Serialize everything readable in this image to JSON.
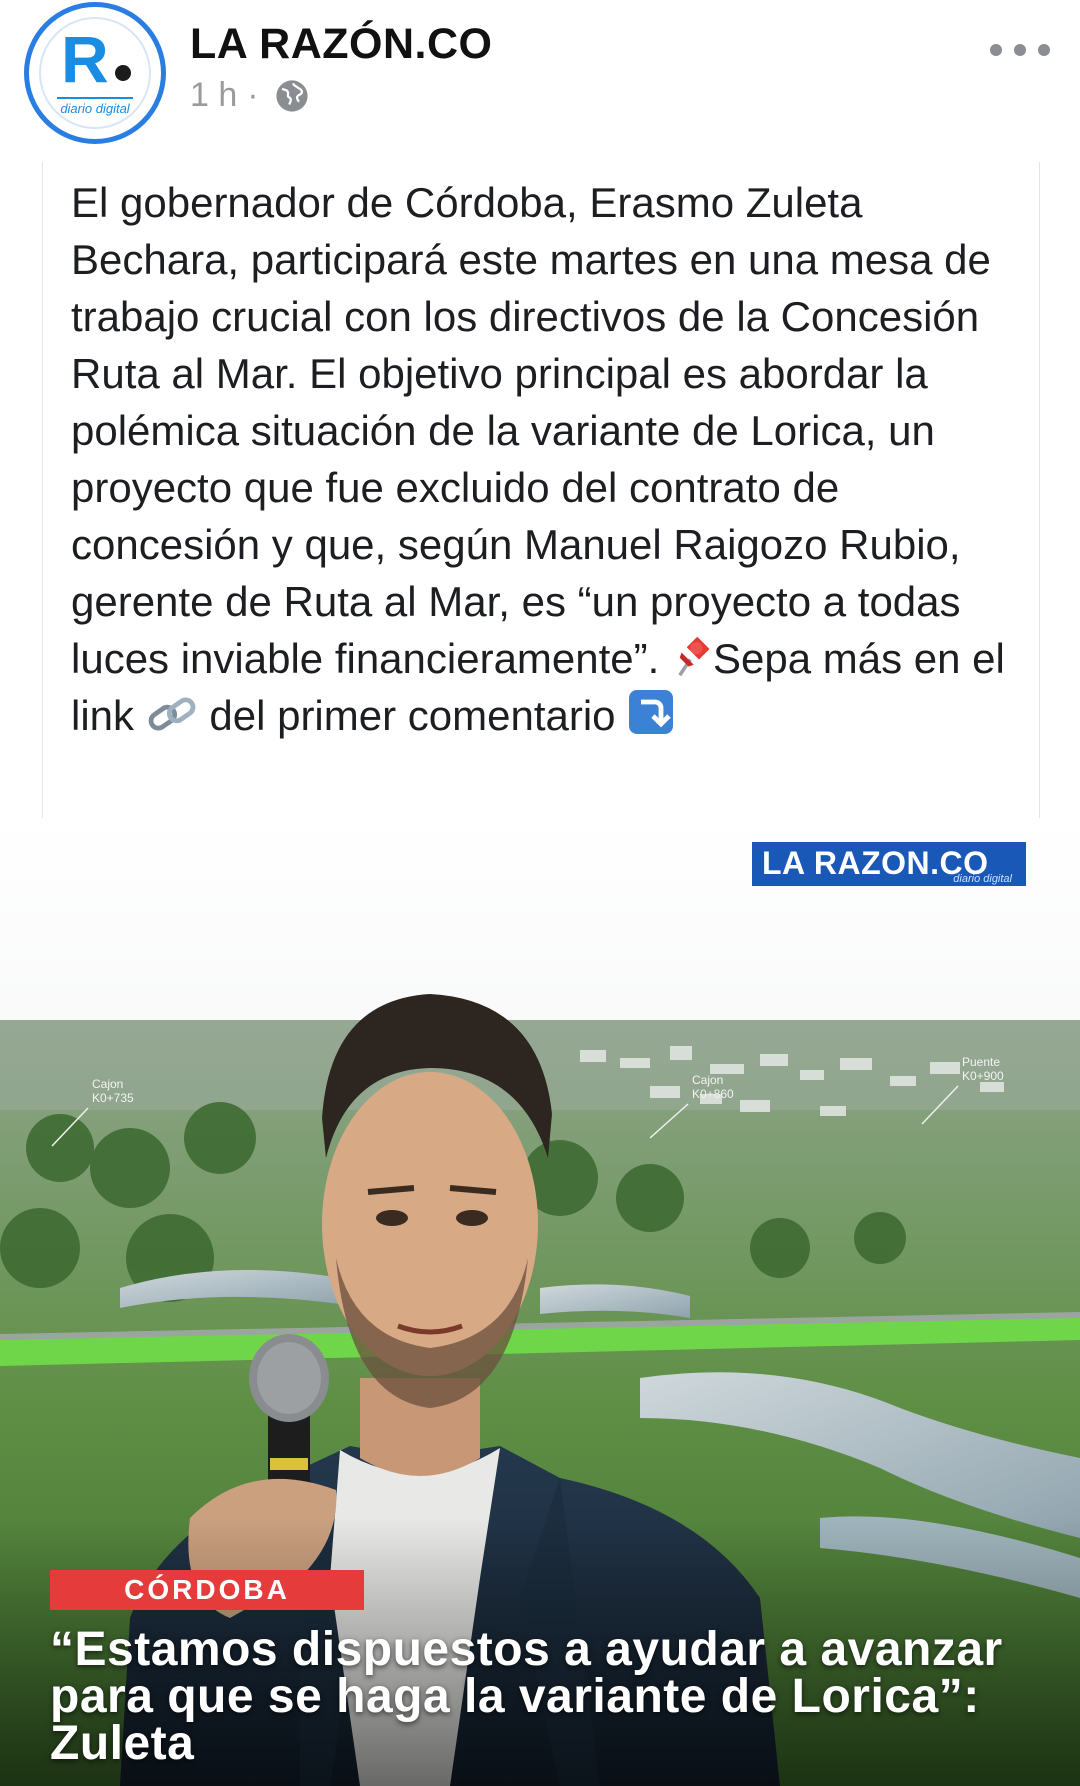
{
  "post": {
    "page_name": "LA RAZÓN.CO",
    "avatar": {
      "letter": "R",
      "tagline": "diario digital"
    },
    "time": "1 h",
    "separator": "·",
    "audience_icon": "globe-icon",
    "more_icon": "more-options-icon",
    "text_main": "El gobernador de Córdoba, Erasmo Zuleta Bechara, participará este martes en una mesa de trabajo crucial con los directivos de la Concesión Ruta al Mar. El objetivo principal es abordar la polémica situación de la variante de Lorica, un proyecto que fue excluido del contrato de concesión y que, según Manuel Raigozo Rubio, gerente de Ruta al Mar, es “un proyecto a todas luces inviable financieramente”. ",
    "text_after_pin": "Sepa más en el link ",
    "text_after_link": " del primer comentario "
  },
  "image": {
    "watermark_title": "LA RAZON.CO",
    "watermark_sub": "diario digital",
    "category": "CÓRDOBA",
    "headline": "“Estamos dispuestos a ayudar a avanzar para que se haga la variante de Lorica”: Zuleta",
    "map_labels": {
      "label_1": "Cajon",
      "label_1b": "K0+735",
      "label_2": "Cajon",
      "label_2b": "K0+860",
      "label_3": "Puente",
      "label_3b": "K0+900"
    }
  },
  "colors": {
    "accent_blue": "#2a7de1",
    "watermark_blue": "#1a58b8",
    "category_red": "#e53b3b",
    "road_green": "#6fd64a"
  }
}
